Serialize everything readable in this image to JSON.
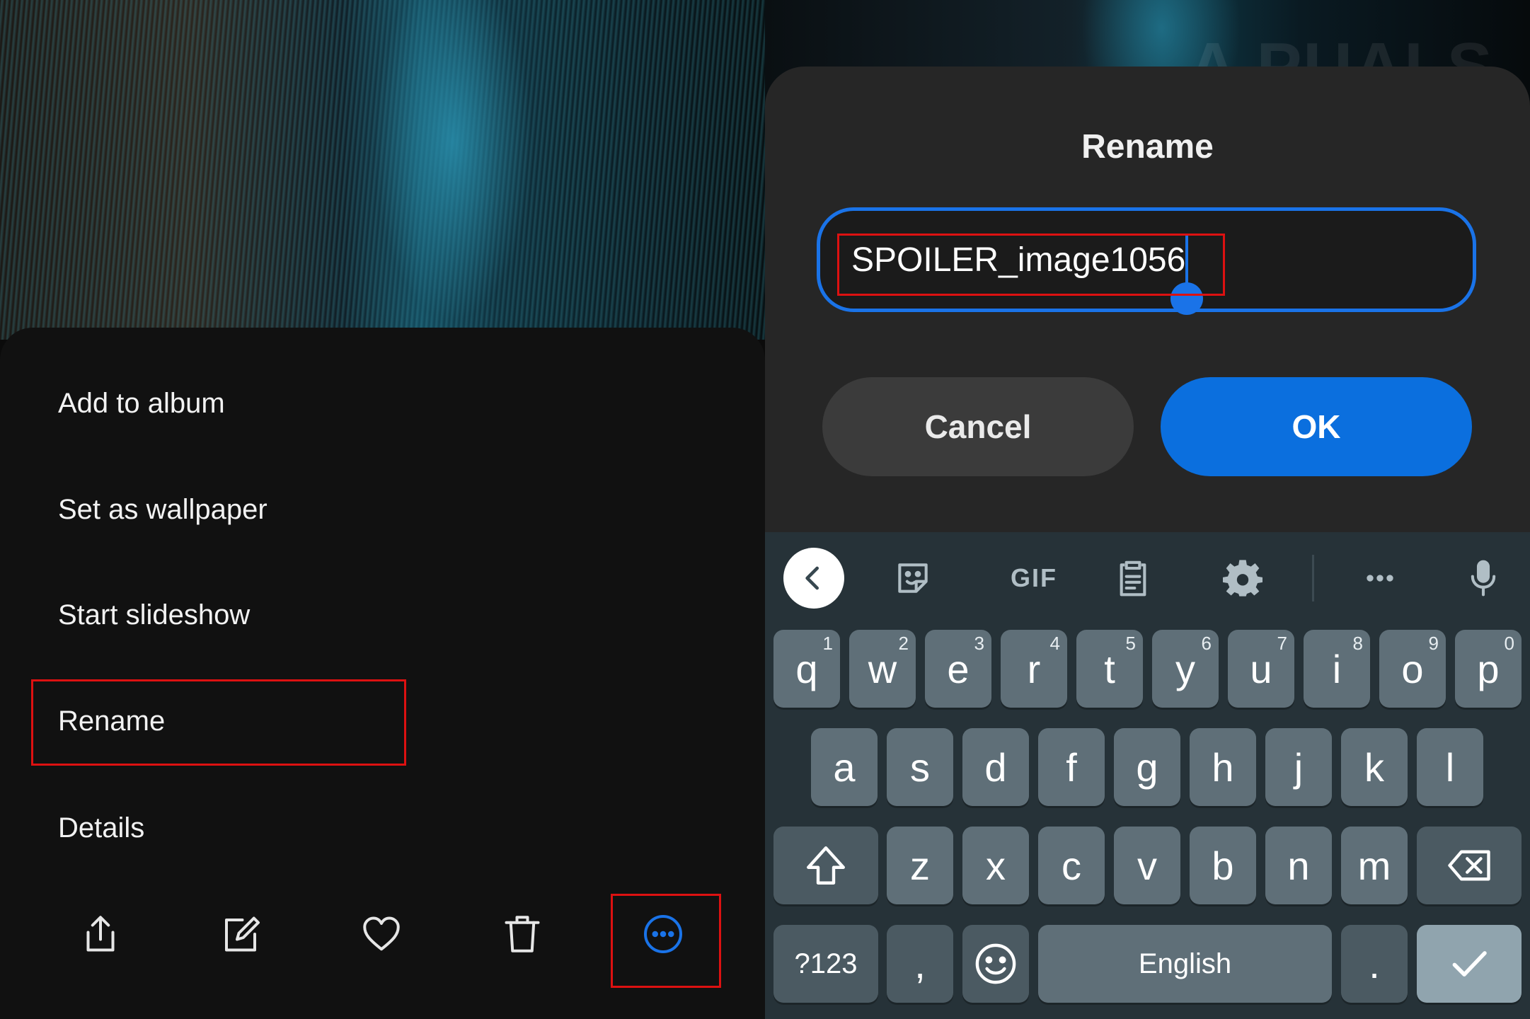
{
  "left_panel": {
    "menu": {
      "items": [
        {
          "label": "Add to album"
        },
        {
          "label": "Set as wallpaper"
        },
        {
          "label": "Start slideshow"
        },
        {
          "label": "Rename"
        },
        {
          "label": "Details"
        }
      ]
    },
    "bottom_bar": {
      "icons": [
        "share-icon",
        "edit-icon",
        "heart-icon",
        "delete-icon",
        "more-icon"
      ]
    },
    "accent": "#1a73e8",
    "highlight_color": "#dd1111"
  },
  "right_panel": {
    "watermark": "A  PUALS",
    "dialog": {
      "title": "Rename",
      "field_value": "SPOILER_image1056",
      "cancel_label": "Cancel",
      "ok_label": "OK"
    },
    "keyboard": {
      "toolbar": {
        "icons": [
          "back-icon",
          "sticker-icon",
          "gif",
          "clipboard-icon",
          "settings-icon",
          "more-icon",
          "mic-icon"
        ],
        "gif_label": "GIF"
      },
      "row1": [
        {
          "key": "q",
          "hint": "1"
        },
        {
          "key": "w",
          "hint": "2"
        },
        {
          "key": "e",
          "hint": "3"
        },
        {
          "key": "r",
          "hint": "4"
        },
        {
          "key": "t",
          "hint": "5"
        },
        {
          "key": "y",
          "hint": "6"
        },
        {
          "key": "u",
          "hint": "7"
        },
        {
          "key": "i",
          "hint": "8"
        },
        {
          "key": "o",
          "hint": "9"
        },
        {
          "key": "p",
          "hint": "0"
        }
      ],
      "row2": [
        "a",
        "s",
        "d",
        "f",
        "g",
        "h",
        "j",
        "k",
        "l"
      ],
      "row3": [
        "z",
        "x",
        "c",
        "v",
        "b",
        "n",
        "m"
      ],
      "bottom_row": {
        "symbols_label": "?123",
        "comma": ",",
        "space_label": "English",
        "period": "."
      },
      "colors": {
        "background": "#263238",
        "key": "#5f6f78",
        "action": "#90a4ae"
      }
    }
  }
}
